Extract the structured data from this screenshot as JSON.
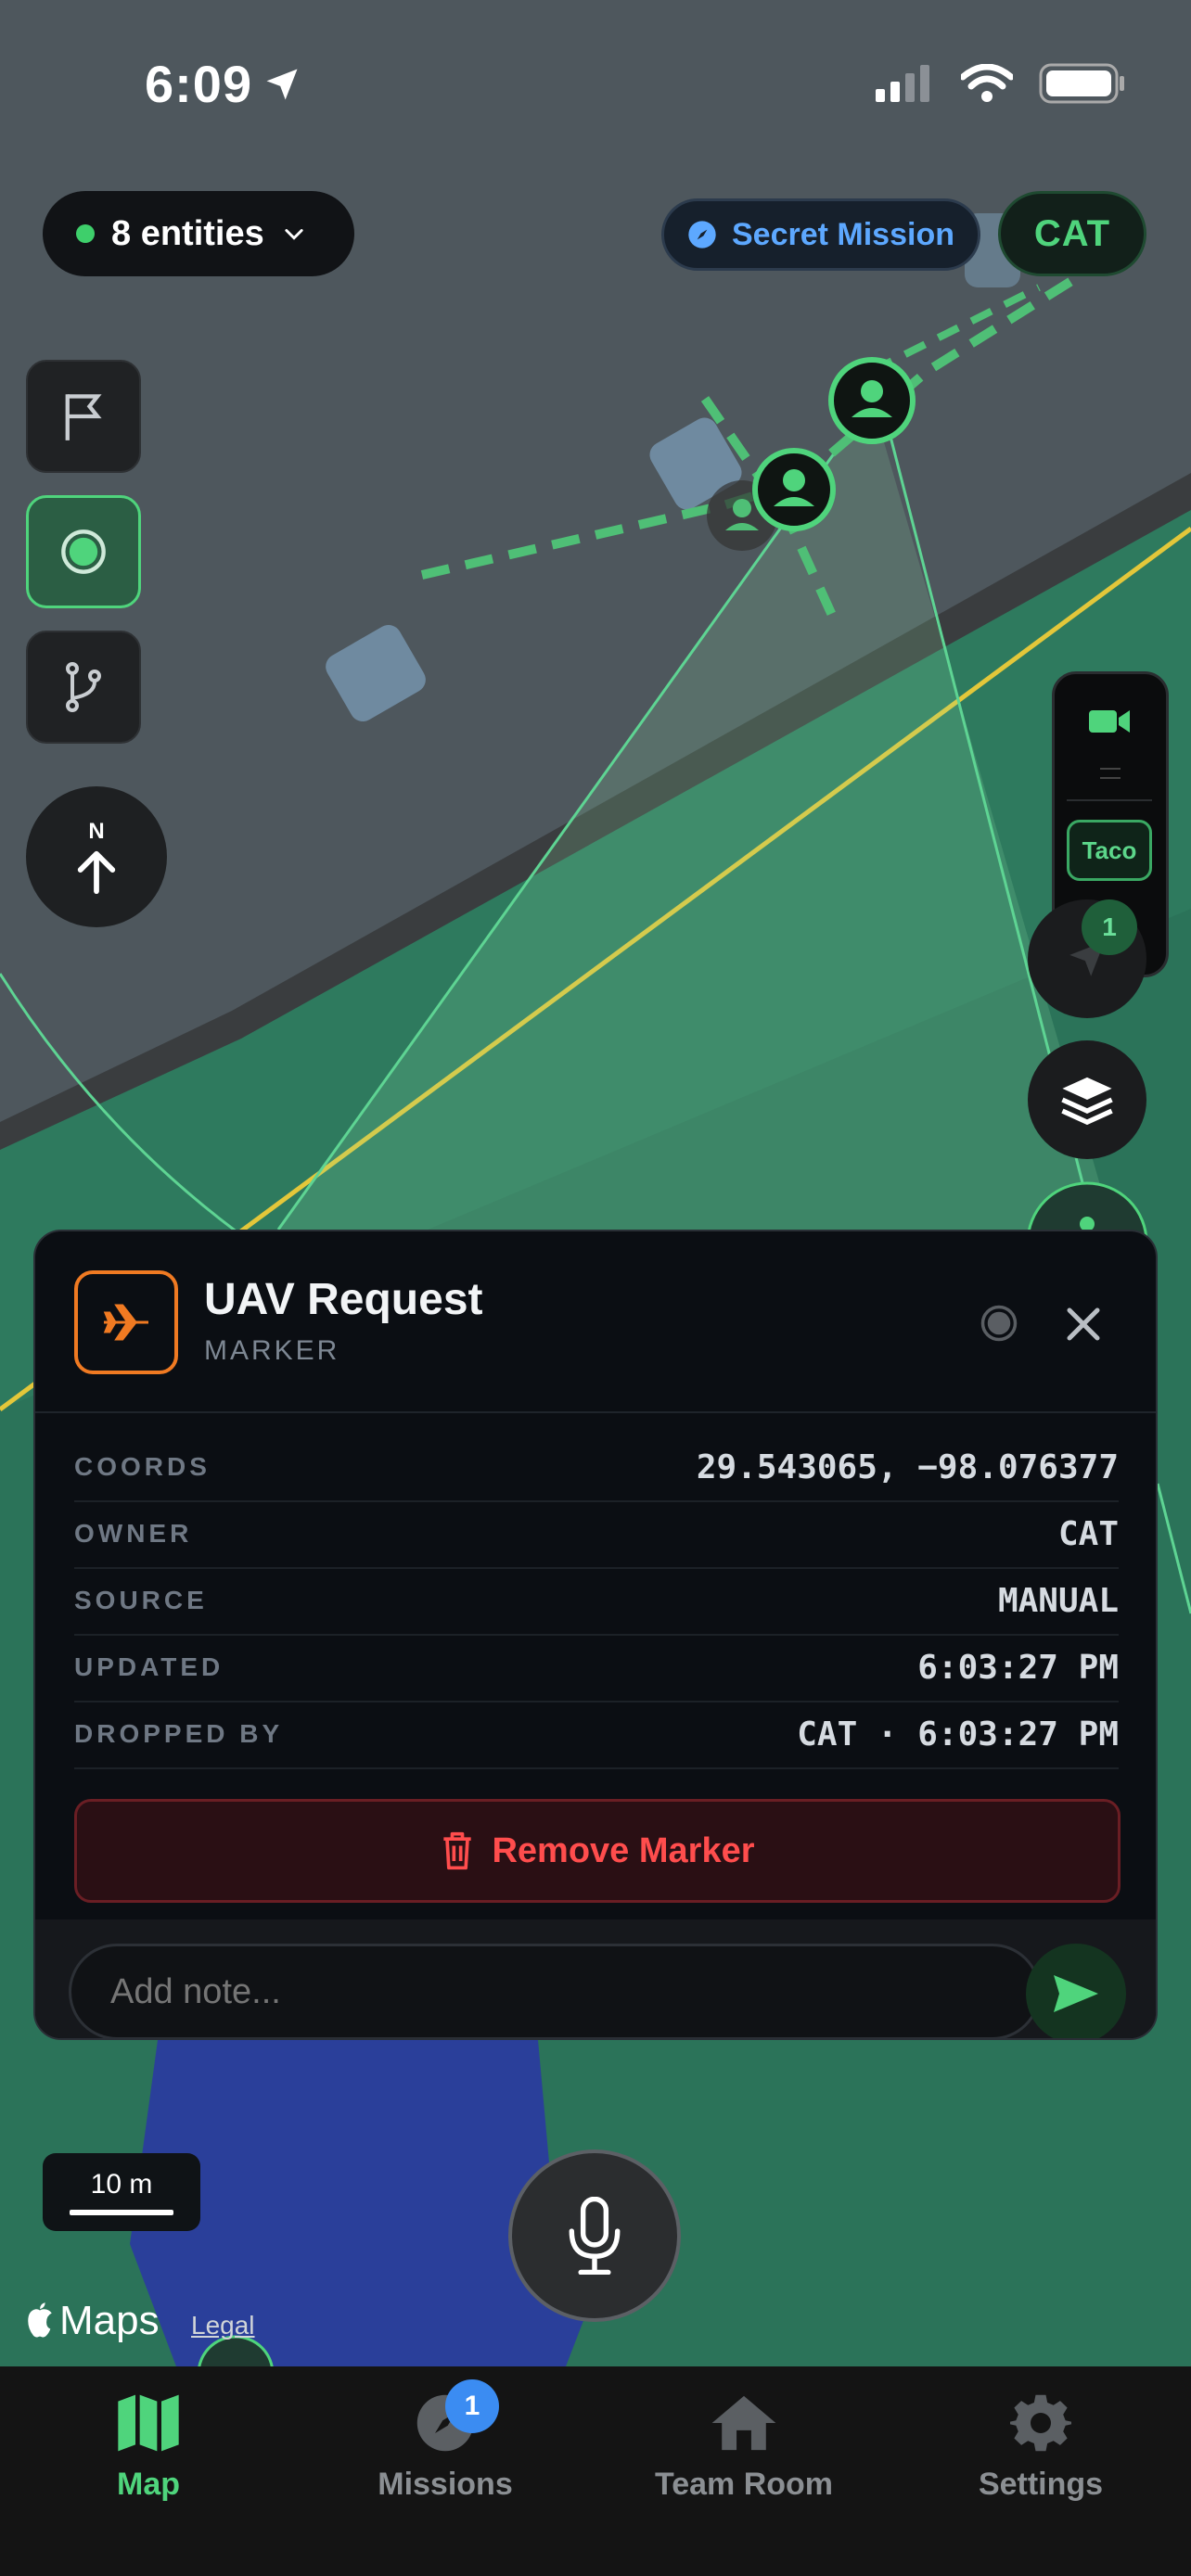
{
  "status_bar": {
    "time": "6:09"
  },
  "top": {
    "entities_label": "8 entities",
    "mission_label": "Secret Mission",
    "user_label": "CAT"
  },
  "compass": {
    "north_label": "N"
  },
  "right_panel": {
    "taco_label": "Taco",
    "badge_count": "1"
  },
  "card": {
    "title": "UAV Request",
    "subtitle": "MARKER",
    "rows": [
      {
        "key": "COORDS",
        "value": "29.543065, −98.076377"
      },
      {
        "key": "OWNER",
        "value": "CAT"
      },
      {
        "key": "SOURCE",
        "value": "MANUAL"
      },
      {
        "key": "UPDATED",
        "value": "6:03:27 PM"
      },
      {
        "key": "DROPPED BY",
        "value": "CAT · 6:03:27 PM"
      }
    ],
    "remove_label": "Remove Marker",
    "note_placeholder": "Add note..."
  },
  "map": {
    "scale_label": "10 m",
    "attribution": "Maps",
    "legal_label": "Legal"
  },
  "tabs": [
    {
      "label": "Map",
      "icon": "map-icon",
      "active": true
    },
    {
      "label": "Missions",
      "icon": "compass-icon",
      "badge": "1"
    },
    {
      "label": "Team Room",
      "icon": "house-icon"
    },
    {
      "label": "Settings",
      "icon": "gear-icon"
    }
  ],
  "colors": {
    "accent_green": "#4fd47c",
    "marker_orange": "#f07a22",
    "danger_red": "#ff4d4d",
    "mission_blue": "#5da8ff",
    "badge_blue": "#3b8cf2"
  }
}
